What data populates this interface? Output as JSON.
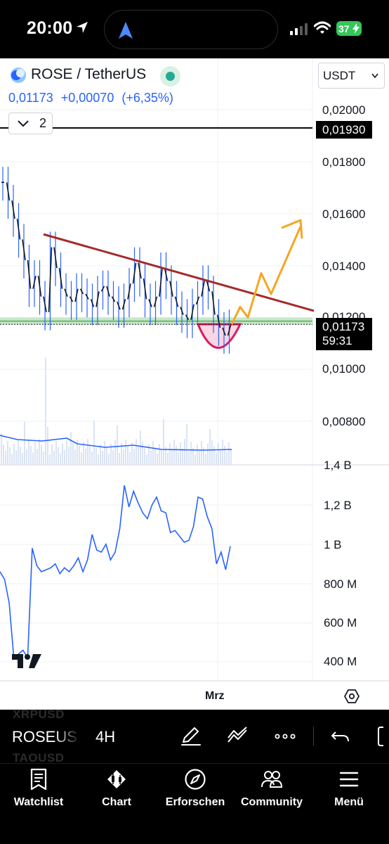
{
  "status_bar": {
    "time": "20:00",
    "battery": "37"
  },
  "symbol": {
    "name": "ROSE / TetherUS",
    "price": "0,01173",
    "change": "+0,00070",
    "change_pct": "(+6,35%)",
    "quote_currency": "USDT",
    "indicator_count": "2"
  },
  "price_axis": {
    "ticks": [
      "0,02000",
      "0,01800",
      "0,01600",
      "0,01400",
      "0,01200",
      "0,01000",
      "0,00800"
    ],
    "alert_tag": "0,01930",
    "price_tag": "0,01173",
    "countdown": "59:31"
  },
  "indicator_axis": {
    "ticks": [
      "1,4 B",
      "1,2 B",
      "1 B",
      "800 M",
      "600 M",
      "400 M"
    ]
  },
  "time_axis": {
    "label": "Mrz"
  },
  "chart_data": {
    "type": "line",
    "title": "ROSE / TetherUS",
    "price_ylim": [
      0.0068,
      0.0207
    ],
    "indicator_ylim": [
      340000000,
      1440000000
    ],
    "candles_approx_close": [
      0.0172,
      0.0165,
      0.0158,
      0.015,
      0.0142,
      0.0131,
      0.0136,
      0.0128,
      0.0122,
      0.0147,
      0.0139,
      0.0131,
      0.0128,
      0.0126,
      0.0131,
      0.0129,
      0.0127,
      0.0124,
      0.013,
      0.0132,
      0.0128,
      0.0126,
      0.0123,
      0.0127,
      0.0133,
      0.0141,
      0.0135,
      0.0127,
      0.0124,
      0.0128,
      0.0139,
      0.0134,
      0.0128,
      0.0124,
      0.0121,
      0.0119,
      0.0125,
      0.0128,
      0.0134,
      0.013,
      0.0121,
      0.0116,
      0.0113,
      0.0117
    ],
    "indicator_series_approx": [
      860,
      820,
      700,
      420,
      440,
      460,
      420,
      980,
      890,
      860,
      870,
      880,
      900,
      850,
      880,
      860,
      890,
      930,
      860,
      920,
      1050,
      970,
      960,
      1000,
      920,
      960,
      1080,
      1300,
      1190,
      1270,
      1210,
      1160,
      1130,
      1200,
      1240,
      1170,
      1160,
      1060,
      1070,
      1040,
      1010,
      1020,
      1090,
      1240,
      1230,
      1140,
      1080,
      900,
      960,
      870,
      990
    ],
    "annotations": {
      "resistance_line": [
        0.0152,
        0.01225
      ],
      "support_level": 0.0118,
      "horizontal_line": 0.0193,
      "projection": [
        0.01173,
        0.0124,
        0.012,
        0.0137,
        0.0129,
        0.0155
      ]
    }
  },
  "toolbar": {
    "ticker": "ROSEUS",
    "ticker_prev": "XRPUSD",
    "ticker_next": "TAOUSD",
    "interval": "4H"
  },
  "nav": {
    "watchlist": "Watchlist",
    "chart": "Chart",
    "explore": "Erforschen",
    "community": "Community",
    "menu": "Menü"
  }
}
